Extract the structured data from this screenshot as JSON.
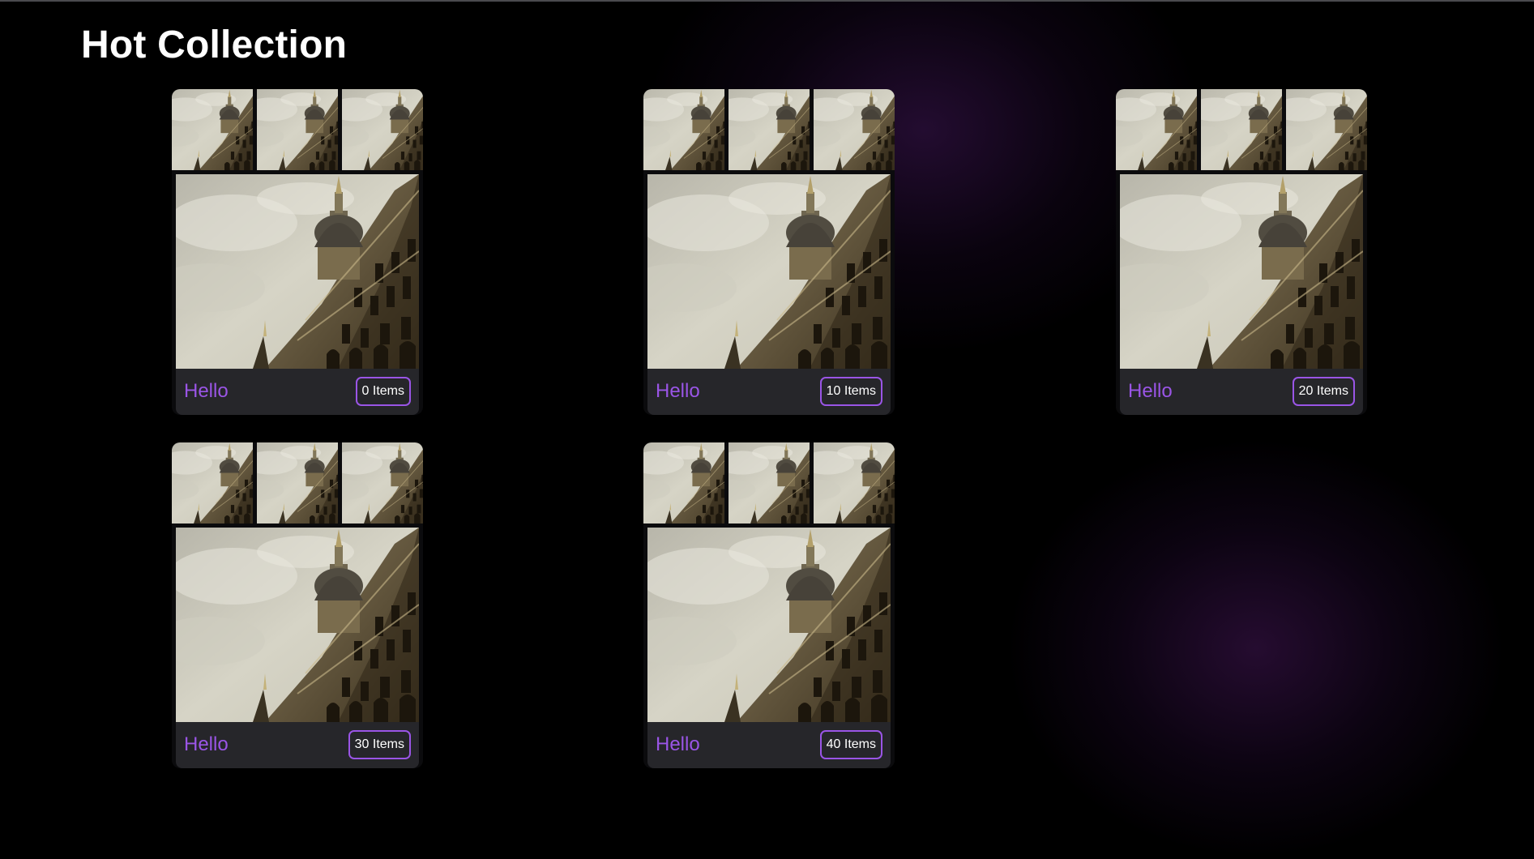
{
  "page": {
    "title": "Hot Collection"
  },
  "collections": [
    {
      "name": "Hello",
      "items_label": "0 Items"
    },
    {
      "name": "Hello",
      "items_label": "10 Items"
    },
    {
      "name": "Hello",
      "items_label": "20 Items"
    },
    {
      "name": "Hello",
      "items_label": "30 Items"
    },
    {
      "name": "Hello",
      "items_label": "40 Items"
    }
  ],
  "colors": {
    "accent": "#9a55e6",
    "background": "#000000",
    "card_footer": "#26262a"
  }
}
